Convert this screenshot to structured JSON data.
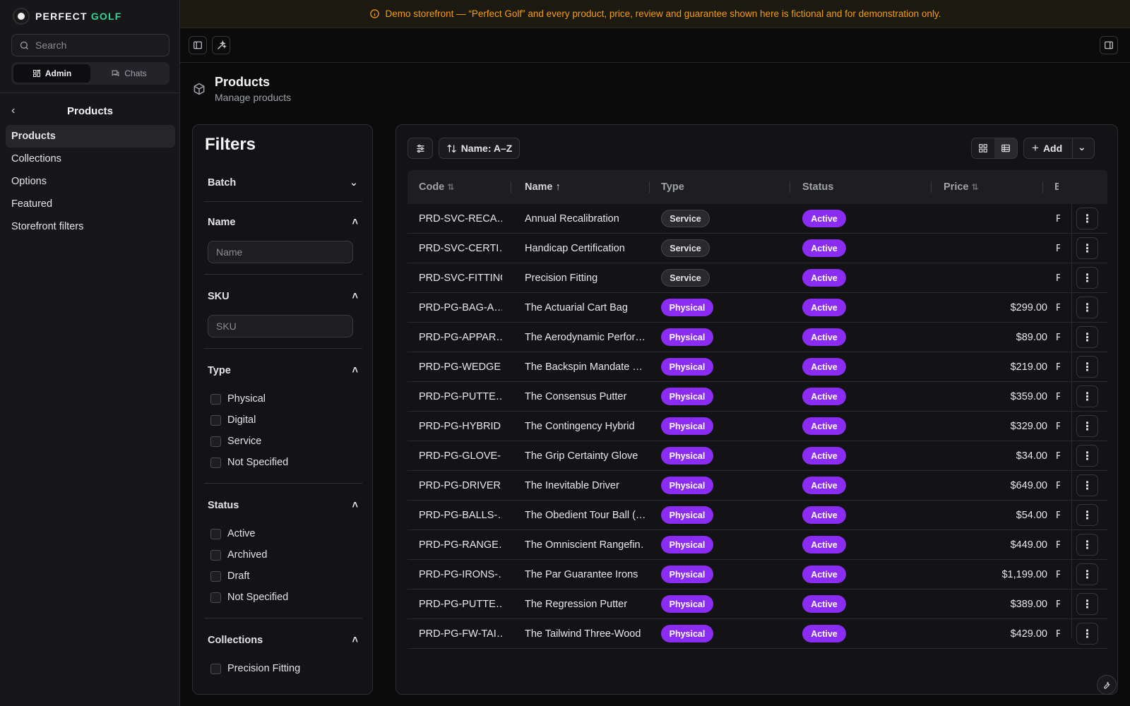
{
  "brand": {
    "name_part1": "PERFECT ",
    "name_part2": "GOLF"
  },
  "search": {
    "placeholder": "Search"
  },
  "mode_switch": {
    "admin": "Admin",
    "chats": "Chats"
  },
  "sidebar": {
    "section_title": "Products",
    "items": [
      {
        "label": "Products",
        "active": true
      },
      {
        "label": "Collections"
      },
      {
        "label": "Options"
      },
      {
        "label": "Featured"
      },
      {
        "label": "Storefront filters"
      }
    ]
  },
  "banner": {
    "text": "Demo storefront — “Perfect Golf” and every product, price, review and guarantee shown here is fictional and for demonstration only.",
    "color": "#f59e0b"
  },
  "page": {
    "title": "Products",
    "subtitle": "Manage products"
  },
  "filters": {
    "title": "Filters",
    "batch": "Batch",
    "name": {
      "label": "Name",
      "placeholder": "Name"
    },
    "sku": {
      "label": "SKU",
      "placeholder": "SKU"
    },
    "type": {
      "label": "Type",
      "options": [
        "Physical",
        "Digital",
        "Service",
        "Not Specified"
      ]
    },
    "status": {
      "label": "Status",
      "options": [
        "Active",
        "Archived",
        "Draft",
        "Not Specified"
      ]
    },
    "collections": {
      "label": "Collections",
      "options": [
        "Precision Fitting"
      ]
    }
  },
  "toolbar": {
    "sort_label": "Name: A–Z",
    "add_label": "Add"
  },
  "table": {
    "columns": {
      "code": "Code",
      "name": "Name",
      "type": "Type",
      "status": "Status",
      "price": "Price"
    },
    "rows": [
      {
        "code": "PRD-SVC-RECA…",
        "name": "Annual Recalibration",
        "type": "Service",
        "status": "Active",
        "price": "",
        "edge": "F"
      },
      {
        "code": "PRD-SVC-CERTI…",
        "name": "Handicap Certification",
        "type": "Service",
        "status": "Active",
        "price": "",
        "edge": "F"
      },
      {
        "code": "PRD-SVC-FITTING",
        "name": "Precision Fitting",
        "type": "Service",
        "status": "Active",
        "price": "",
        "edge": "F"
      },
      {
        "code": "PRD-PG-BAG-A…",
        "name": "The Actuarial Cart Bag",
        "type": "Physical",
        "status": "Active",
        "price": "$299.00",
        "edge": "F"
      },
      {
        "code": "PRD-PG-APPAR…",
        "name": "The Aerodynamic Perfor…",
        "type": "Physical",
        "status": "Active",
        "price": "$89.00",
        "edge": "F"
      },
      {
        "code": "PRD-PG-WEDGE…",
        "name": "The Backspin Mandate …",
        "type": "Physical",
        "status": "Active",
        "price": "$219.00",
        "edge": "F"
      },
      {
        "code": "PRD-PG-PUTTE…",
        "name": "The Consensus Putter",
        "type": "Physical",
        "status": "Active",
        "price": "$359.00",
        "edge": "F"
      },
      {
        "code": "PRD-PG-HYBRID…",
        "name": "The Contingency Hybrid",
        "type": "Physical",
        "status": "Active",
        "price": "$329.00",
        "edge": "F"
      },
      {
        "code": "PRD-PG-GLOVE-…",
        "name": "The Grip Certainty Glove",
        "type": "Physical",
        "status": "Active",
        "price": "$34.00",
        "edge": "F"
      },
      {
        "code": "PRD-PG-DRIVER…",
        "name": "The Inevitable Driver",
        "type": "Physical",
        "status": "Active",
        "price": "$649.00",
        "edge": "F"
      },
      {
        "code": "PRD-PG-BALLS-…",
        "name": "The Obedient Tour Ball (…",
        "type": "Physical",
        "status": "Active",
        "price": "$54.00",
        "edge": "F"
      },
      {
        "code": "PRD-PG-RANGE…",
        "name": "The Omniscient Rangefin…",
        "type": "Physical",
        "status": "Active",
        "price": "$449.00",
        "edge": "F"
      },
      {
        "code": "PRD-PG-IRONS-…",
        "name": "The Par Guarantee Irons",
        "type": "Physical",
        "status": "Active",
        "price": "$1,199.00",
        "edge": "F"
      },
      {
        "code": "PRD-PG-PUTTE…",
        "name": "The Regression Putter",
        "type": "Physical",
        "status": "Active",
        "price": "$389.00",
        "edge": "F"
      },
      {
        "code": "PRD-PG-FW-TAI…",
        "name": "The Tailwind Three-Wood",
        "type": "Physical",
        "status": "Active",
        "price": "$429.00",
        "edge": "F"
      }
    ]
  },
  "accent_color": "#8b2cf5"
}
